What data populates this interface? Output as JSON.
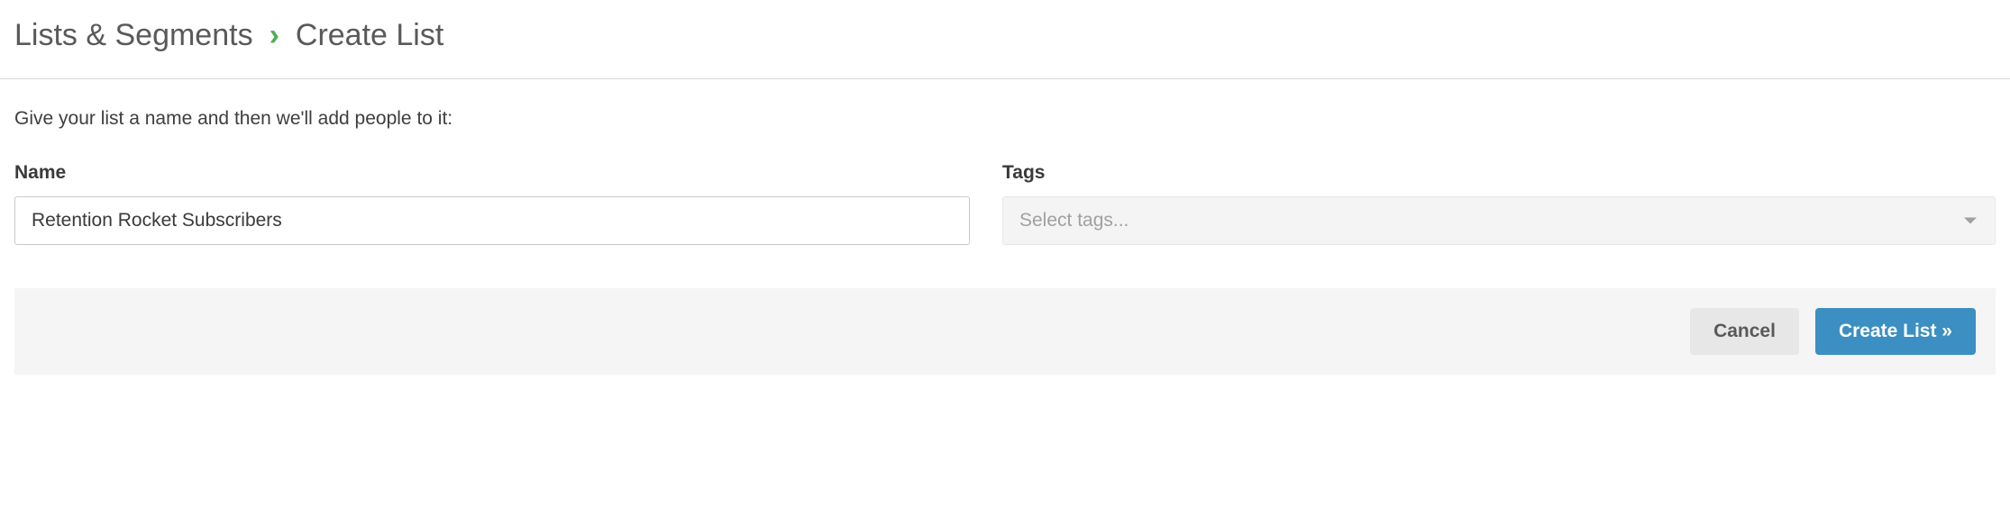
{
  "breadcrumb": {
    "parent": "Lists & Segments",
    "separator": "›",
    "current": "Create List"
  },
  "intro_text": "Give your list a name and then we'll add people to it:",
  "form": {
    "name_label": "Name",
    "name_value": "Retention Rocket Subscribers",
    "tags_label": "Tags",
    "tags_placeholder": "Select tags..."
  },
  "actions": {
    "cancel_label": "Cancel",
    "submit_label": "Create List »"
  }
}
